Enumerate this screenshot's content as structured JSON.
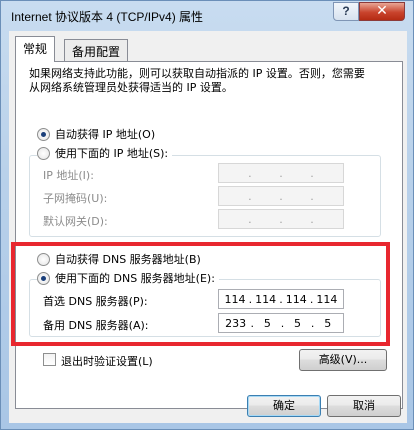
{
  "window": {
    "title": "Internet 协议版本 4 (TCP/IPv4) 属性",
    "help_label": "?",
    "close_label": "✕"
  },
  "tabs": [
    {
      "label": "常规",
      "active": true
    },
    {
      "label": "备用配置",
      "active": false
    }
  ],
  "description": "如果网络支持此功能，则可以获取自动指派的 IP 设置。否则，您需要从网络系统管理员处获得适当的 IP 设置。",
  "ip_section": {
    "auto_label": "自动获得 IP 地址(O)",
    "auto_selected": true,
    "manual_label": "使用下面的 IP 地址(S):",
    "manual_selected": false,
    "fields": [
      {
        "label": "IP 地址(I):",
        "octets": [
          "",
          "",
          "",
          ""
        ]
      },
      {
        "label": "子网掩码(U):",
        "octets": [
          "",
          "",
          "",
          ""
        ]
      },
      {
        "label": "默认网关(D):",
        "octets": [
          "",
          "",
          "",
          ""
        ]
      }
    ]
  },
  "dns_section": {
    "auto_label": "自动获得 DNS 服务器地址(B)",
    "auto_selected": false,
    "manual_label": "使用下面的 DNS 服务器地址(E):",
    "manual_selected": true,
    "fields": [
      {
        "label": "首选 DNS 服务器(P):",
        "octets": [
          "114",
          "114",
          "114",
          "114"
        ]
      },
      {
        "label": "备用 DNS 服务器(A):",
        "octets": [
          "233",
          "5",
          "5",
          "5"
        ]
      }
    ]
  },
  "validate_label": "退出时验证设置(L)",
  "advanced_label": "高级(V)...",
  "ok_label": "确定",
  "cancel_label": "取消",
  "colors": {
    "highlight": "#e8272f",
    "accent": "#3c7fb1"
  }
}
